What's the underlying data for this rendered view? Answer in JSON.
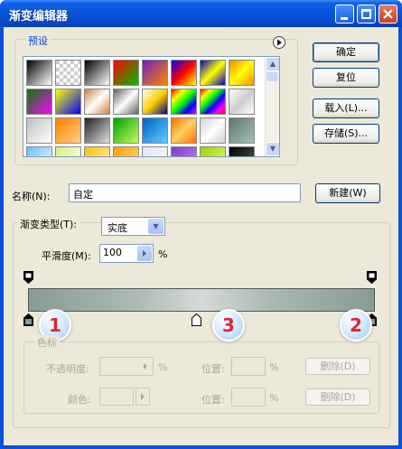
{
  "window": {
    "title": "渐变编辑器"
  },
  "presets": {
    "label": "预设",
    "swatches": [
      [
        "linear-gradient(135deg,#000,#fff)",
        "repeating-conic-gradient(#fff 0 25%,#ccc 0 50%) 0 0/8px 8px",
        "linear-gradient(135deg,#000,#fff)",
        "linear-gradient(135deg,#ff0000,#00c000)",
        "linear-gradient(135deg,#6c1cc0,#ff8800)",
        "linear-gradient(135deg,#0000ff,#ff0000,#ffff00)",
        "linear-gradient(135deg,#0000c0,#ffff00,#0000c0)",
        "linear-gradient(135deg,#ff8800,#ffff00,#ff8800)"
      ],
      [
        "linear-gradient(135deg,#008000,#ff00ff)",
        "linear-gradient(135deg,#ffff00,#0000ff)",
        "linear-gradient(135deg,#d08040,#ffffff,#d08040)",
        "linear-gradient(135deg,#606060,#ffffff,#606060)",
        "linear-gradient(135deg,#ffffff,#ffd000,#000080)",
        "linear-gradient(135deg,#ff0000,#ffff00,#00ff00,#0000ff,#ff00ff)",
        "linear-gradient(135deg,#ff0000,#ffff00,#00ff00,#0000ff,#ff00ff,#ff0000)",
        "linear-gradient(135deg,#ffffff,#cccccc,#ffffff)"
      ],
      [
        "linear-gradient(135deg,#c0c0c0,#ffffff)",
        "linear-gradient(135deg,#ff8000,#ffd080)",
        "linear-gradient(135deg,#202020,#e0e0e0)",
        "linear-gradient(135deg,#00a000,#c0ff60)",
        "linear-gradient(135deg,#0060c0,#60d0ff)",
        "linear-gradient(135deg,#ff7000,#ffd060,#ff7000)",
        "linear-gradient(135deg,#d0d0d0,#ffffff,#d0d0d0)",
        "linear-gradient(135deg,#5c7a6e,#a6bdb3)"
      ],
      [
        "linear-gradient(135deg,#60c0ff,#ffffff)",
        "linear-gradient(135deg,#d0f080,#ffffff)",
        "linear-gradient(135deg,#ffc000,#fff8c0)",
        "linear-gradient(135deg,#ffa000,#ffe080)",
        "linear-gradient(135deg,#e0e0ff,#ffffff)",
        "linear-gradient(135deg,#8040c0,#c080ff)",
        "linear-gradient(135deg,#a0d000,#e0ff80)",
        "linear-gradient(135deg,#000000,#606060)"
      ]
    ]
  },
  "buttons": {
    "ok": "确定",
    "reset": "复位",
    "load": "载入(L)...",
    "save": "存储(S)...",
    "new": "新建(W)"
  },
  "name": {
    "label": "名称(N):",
    "value": "自定"
  },
  "gradient_type": {
    "label": "渐变类型(T):",
    "value": "实底"
  },
  "smoothness": {
    "label": "平滑度(M):",
    "value": "100",
    "unit": "%"
  },
  "color_stops": {
    "label": "色标",
    "opacity_label": "不透明度:",
    "opacity_unit": "%",
    "location_label_1": "位置:",
    "location_unit_1": "%",
    "delete_label_1": "删除(D)",
    "color_label": "颜色:",
    "location_label_2": "位置:",
    "location_unit_2": "%",
    "delete_label_2": "删除(D)"
  },
  "annotations": {
    "badge_1": "1",
    "badge_2": "2",
    "badge_3": "3"
  },
  "colors": {
    "gradient_end": "#879c95",
    "gradient_mid": "#d5dad8",
    "badge_text": "#d7283a"
  }
}
